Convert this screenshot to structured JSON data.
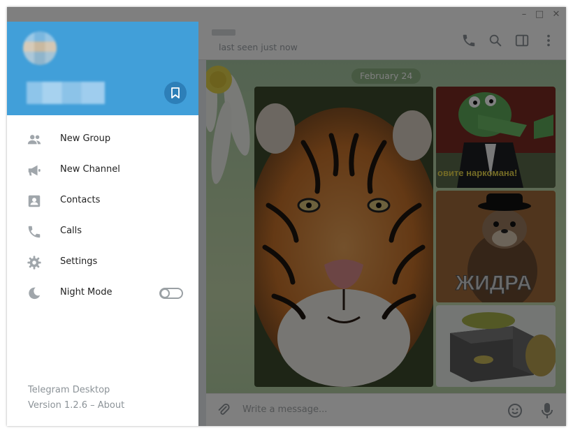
{
  "window": {
    "controls": {
      "minimize": "–",
      "maximize": "□",
      "close": "✕"
    }
  },
  "chat": {
    "status": "last seen just now",
    "date_label": "February 24",
    "input_placeholder": "Write a message...",
    "photos": [
      {
        "name": "tiger-photo"
      },
      {
        "name": "crocodile-photo",
        "caption": "овите наркомана!"
      },
      {
        "name": "otter-photo",
        "caption": "ЖИДРА"
      },
      {
        "name": "fish-brick-photo"
      }
    ]
  },
  "menu": {
    "items": [
      {
        "label": "New Group",
        "icon": "group-icon"
      },
      {
        "label": "New Channel",
        "icon": "megaphone-icon"
      },
      {
        "label": "Contacts",
        "icon": "contact-icon"
      },
      {
        "label": "Calls",
        "icon": "phone-icon"
      },
      {
        "label": "Settings",
        "icon": "gear-icon"
      },
      {
        "label": "Night Mode",
        "icon": "moon-icon"
      }
    ],
    "night_mode_on": false,
    "footer_title": "Telegram Desktop",
    "footer_version": "Version 1.2.6 – About"
  },
  "colors": {
    "accent": "#419fd9",
    "saved_button": "#2d7fb8"
  }
}
